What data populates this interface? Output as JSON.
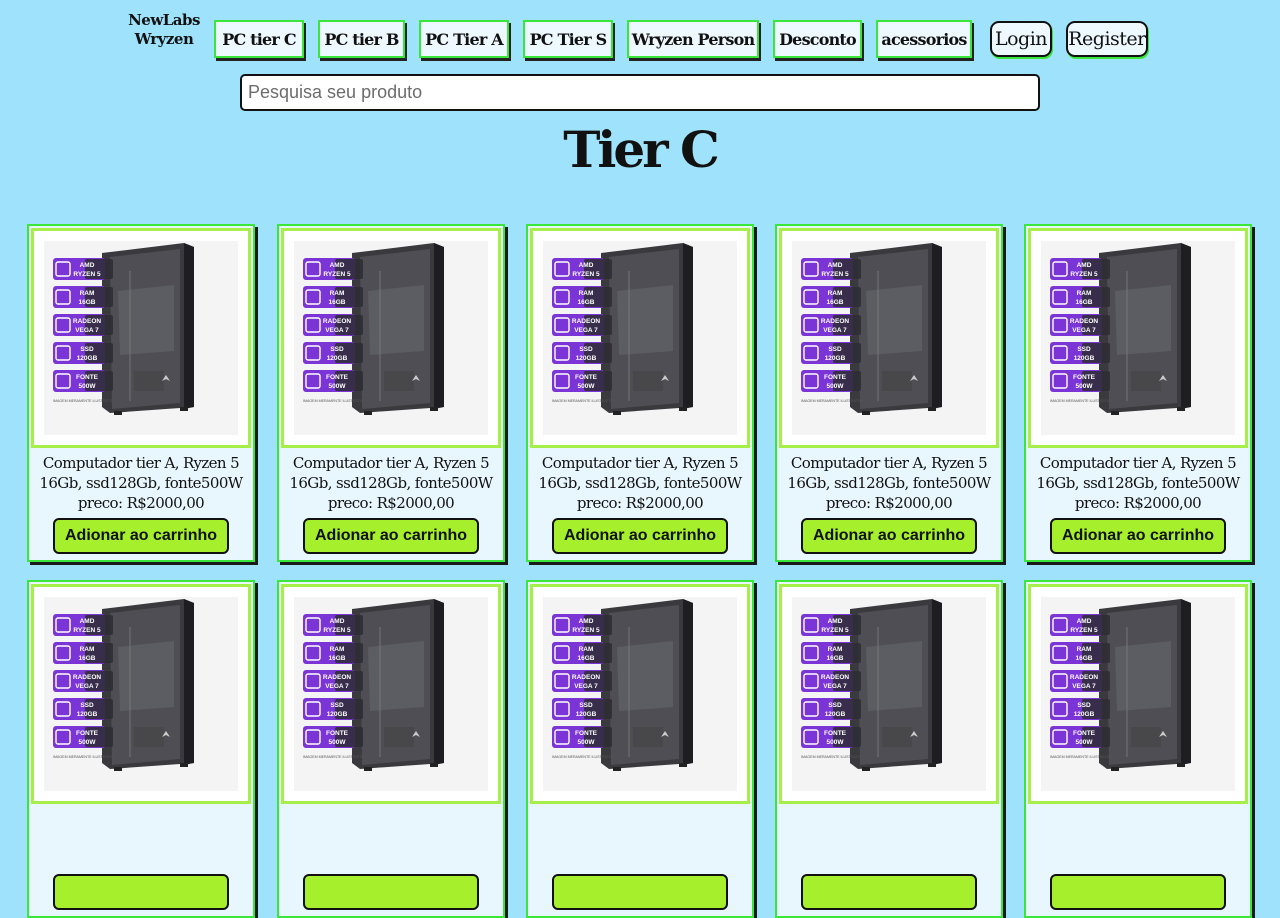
{
  "brand": {
    "line1": "NewLabs",
    "line2": "Wryzen"
  },
  "nav": {
    "items": [
      {
        "label": "PC tier C"
      },
      {
        "label": "PC tier B"
      },
      {
        "label": "PC Tier A"
      },
      {
        "label": "PC Tier S"
      },
      {
        "label": "Wryzen Person"
      },
      {
        "label": "Desconto"
      },
      {
        "label": "acessorios"
      }
    ],
    "login_label": "Login",
    "register_label": "Register"
  },
  "search": {
    "placeholder": "Pesquisa seu produto",
    "value": ""
  },
  "page_title": "Tier C",
  "product_image": {
    "specs": [
      {
        "top": "AMD",
        "bottom": "RYZEN 5"
      },
      {
        "top": "RAM",
        "bottom": "16GB"
      },
      {
        "top": "RADEON",
        "bottom": "VEGA 7"
      },
      {
        "top": "SSD",
        "bottom": "120GB"
      },
      {
        "top": "FONTE",
        "bottom": "500W"
      }
    ],
    "footnote": "IMAGEM MERAMENTE ILUSTRATIVA"
  },
  "products": [
    {
      "name": "Computador tier A, Ryzen 5 16Gb, ssd128Gb, fonte500W",
      "price": "preco: R$2000,00",
      "button": "Adionar ao carrinho"
    },
    {
      "name": "Computador tier A, Ryzen 5 16Gb, ssd128Gb, fonte500W",
      "price": "preco: R$2000,00",
      "button": "Adionar ao carrinho"
    },
    {
      "name": "Computador tier A, Ryzen 5 16Gb, ssd128Gb, fonte500W",
      "price": "preco: R$2000,00",
      "button": "Adionar ao carrinho"
    },
    {
      "name": "Computador tier A, Ryzen 5 16Gb, ssd128Gb, fonte500W",
      "price": "preco: R$2000,00",
      "button": "Adionar ao carrinho"
    },
    {
      "name": "Computador tier A, Ryzen 5 16Gb, ssd128Gb, fonte500W",
      "price": "preco: R$2000,00",
      "button": "Adionar ao carrinho"
    },
    {
      "name": "",
      "price": "",
      "button": ""
    },
    {
      "name": "",
      "price": "",
      "button": ""
    },
    {
      "name": "",
      "price": "",
      "button": ""
    },
    {
      "name": "",
      "price": "",
      "button": ""
    },
    {
      "name": "",
      "price": "",
      "button": ""
    }
  ],
  "colors": {
    "background": "#9ee3fb",
    "accent_green": "#39e639",
    "button_lime": "#a6ef2c",
    "spec_purple": "#7b35d6"
  }
}
